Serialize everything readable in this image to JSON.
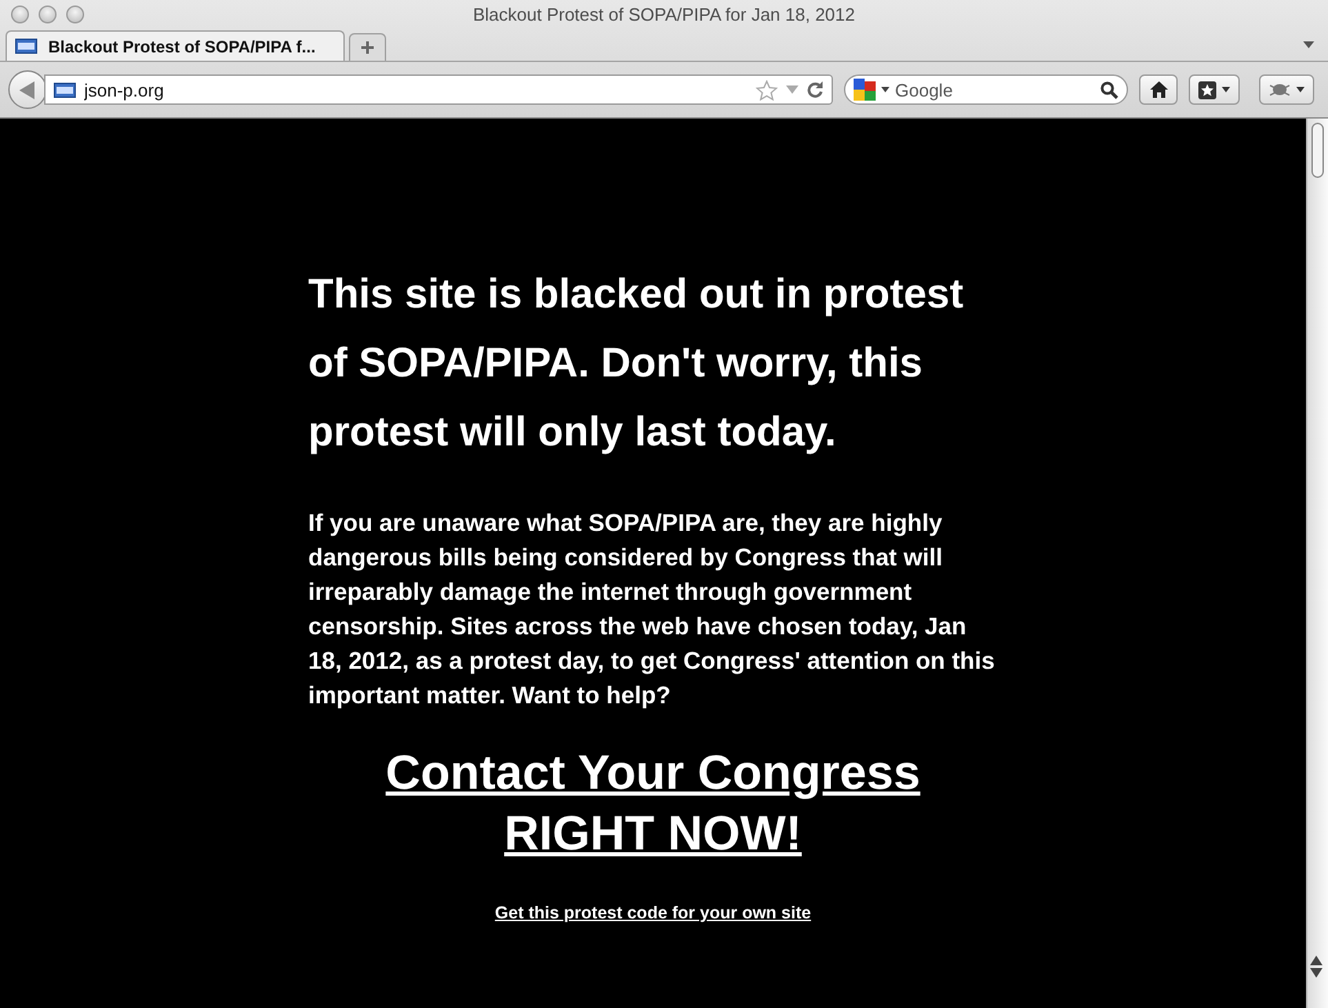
{
  "window": {
    "title": "Blackout Protest of SOPA/PIPA for Jan 18, 2012"
  },
  "tabs": [
    {
      "label": "Blackout Protest of SOPA/PIPA f...",
      "selected": true
    }
  ],
  "address_bar": {
    "value": "json-p.org"
  },
  "search": {
    "placeholder": "Google"
  },
  "page": {
    "heading": "This site is blacked out in protest of SOPA/PIPA. Don't worry, this protest will only last today.",
    "body": "If you are unaware what SOPA/PIPA are, they are highly dangerous bills being considered by Congress that will irreparably damage the internet through government censorship. Sites across the web have chosen today, Jan 18, 2012, as a protest day, to get Congress' attention on this important matter. Want to help?",
    "cta_link": "Contact Your Congress RIGHT NOW!",
    "code_link": "Get this protest code for your own site"
  }
}
